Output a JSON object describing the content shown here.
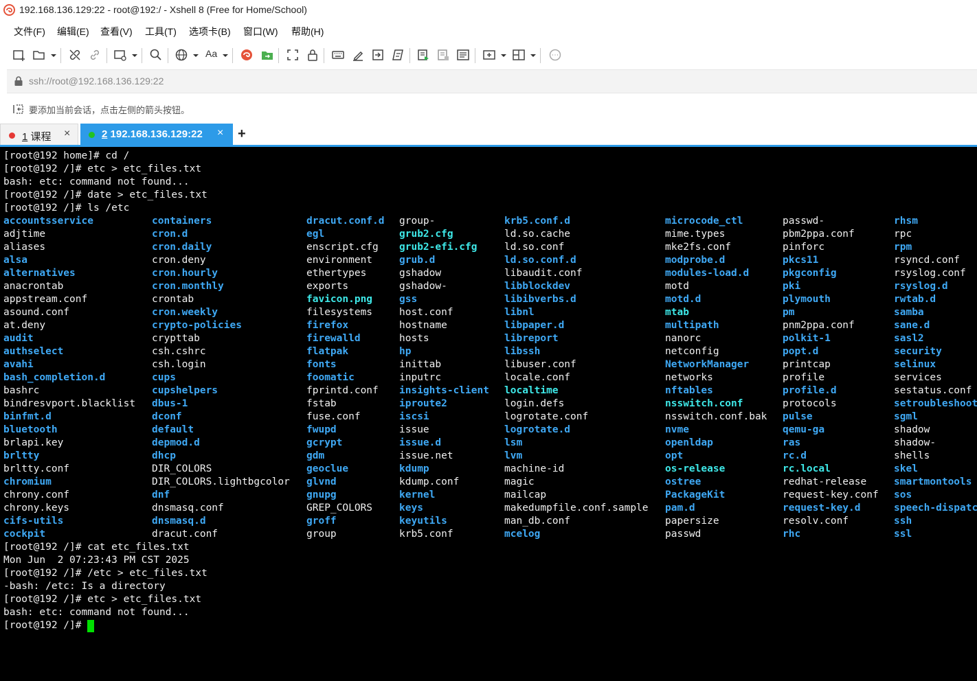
{
  "window": {
    "title": "192.168.136.129:22 - root@192:/ - Xshell 8 (Free for Home/School)"
  },
  "menu": [
    "文件(F)",
    "编辑(E)",
    "查看(V)",
    "工具(T)",
    "选项卡(B)",
    "窗口(W)",
    "帮助(H)"
  ],
  "toolbar": {
    "font_label": "Aa"
  },
  "address": {
    "value": "ssh://root@192.168.136.129:22"
  },
  "hint": {
    "text": "要添加当前会话，点击左侧的箭头按钮。"
  },
  "tabs": [
    {
      "num": "1",
      "label": " 课程",
      "status_color": "#e53935",
      "active": false
    },
    {
      "num": "2",
      "label": " 192.168.136.129:22",
      "status_color": "#22c322",
      "active": true
    }
  ],
  "tab_close_glyph": "×",
  "tab_add_glyph": "+",
  "colors": {
    "accent": "#2d9be8",
    "dir": "#3fa9f5",
    "link": "#3ee8e8",
    "cursor": "#00e000"
  },
  "terminal": {
    "lines_before": [
      "[root@192 home]# cd /",
      "[root@192 /]# etc > etc_files.txt",
      "bash: etc: command not found...",
      "[root@192 /]# date > etc_files.txt",
      "[root@192 /]# ls /etc"
    ],
    "ls_columns": [
      [
        {
          "n": "accountsservice",
          "t": "dir"
        },
        {
          "n": "adjtime",
          "t": "file"
        },
        {
          "n": "aliases",
          "t": "file"
        },
        {
          "n": "alsa",
          "t": "dir"
        },
        {
          "n": "alternatives",
          "t": "dir"
        },
        {
          "n": "anacrontab",
          "t": "file"
        },
        {
          "n": "appstream.conf",
          "t": "file"
        },
        {
          "n": "asound.conf",
          "t": "file"
        },
        {
          "n": "at.deny",
          "t": "file"
        },
        {
          "n": "audit",
          "t": "dir"
        },
        {
          "n": "authselect",
          "t": "dir"
        },
        {
          "n": "avahi",
          "t": "dir"
        },
        {
          "n": "bash_completion.d",
          "t": "dir"
        },
        {
          "n": "bashrc",
          "t": "file"
        },
        {
          "n": "bindresvport.blacklist",
          "t": "file"
        },
        {
          "n": "binfmt.d",
          "t": "dir"
        },
        {
          "n": "bluetooth",
          "t": "dir"
        },
        {
          "n": "brlapi.key",
          "t": "file"
        },
        {
          "n": "brltty",
          "t": "dir"
        },
        {
          "n": "brltty.conf",
          "t": "file"
        },
        {
          "n": "chromium",
          "t": "dir"
        },
        {
          "n": "chrony.conf",
          "t": "file"
        },
        {
          "n": "chrony.keys",
          "t": "file"
        },
        {
          "n": "cifs-utils",
          "t": "dir"
        },
        {
          "n": "cockpit",
          "t": "dir"
        }
      ],
      [
        {
          "n": "containers",
          "t": "dir"
        },
        {
          "n": "cron.d",
          "t": "dir"
        },
        {
          "n": "cron.daily",
          "t": "dir"
        },
        {
          "n": "cron.deny",
          "t": "file"
        },
        {
          "n": "cron.hourly",
          "t": "dir"
        },
        {
          "n": "cron.monthly",
          "t": "dir"
        },
        {
          "n": "crontab",
          "t": "file"
        },
        {
          "n": "cron.weekly",
          "t": "dir"
        },
        {
          "n": "crypto-policies",
          "t": "dir"
        },
        {
          "n": "crypttab",
          "t": "file"
        },
        {
          "n": "csh.cshrc",
          "t": "file"
        },
        {
          "n": "csh.login",
          "t": "file"
        },
        {
          "n": "cups",
          "t": "dir"
        },
        {
          "n": "cupshelpers",
          "t": "dir"
        },
        {
          "n": "dbus-1",
          "t": "dir"
        },
        {
          "n": "dconf",
          "t": "dir"
        },
        {
          "n": "default",
          "t": "dir"
        },
        {
          "n": "depmod.d",
          "t": "dir"
        },
        {
          "n": "dhcp",
          "t": "dir"
        },
        {
          "n": "DIR_COLORS",
          "t": "file"
        },
        {
          "n": "DIR_COLORS.lightbgcolor",
          "t": "file"
        },
        {
          "n": "dnf",
          "t": "dir"
        },
        {
          "n": "dnsmasq.conf",
          "t": "file"
        },
        {
          "n": "dnsmasq.d",
          "t": "dir"
        },
        {
          "n": "dracut.conf",
          "t": "file"
        }
      ],
      [
        {
          "n": "dracut.conf.d",
          "t": "dir"
        },
        {
          "n": "egl",
          "t": "dir"
        },
        {
          "n": "enscript.cfg",
          "t": "file"
        },
        {
          "n": "environment",
          "t": "file"
        },
        {
          "n": "ethertypes",
          "t": "file"
        },
        {
          "n": "exports",
          "t": "file"
        },
        {
          "n": "favicon.png",
          "t": "link"
        },
        {
          "n": "filesystems",
          "t": "file"
        },
        {
          "n": "firefox",
          "t": "dir"
        },
        {
          "n": "firewalld",
          "t": "dir"
        },
        {
          "n": "flatpak",
          "t": "dir"
        },
        {
          "n": "fonts",
          "t": "dir"
        },
        {
          "n": "foomatic",
          "t": "dir"
        },
        {
          "n": "fprintd.conf",
          "t": "file"
        },
        {
          "n": "fstab",
          "t": "file"
        },
        {
          "n": "fuse.conf",
          "t": "file"
        },
        {
          "n": "fwupd",
          "t": "dir"
        },
        {
          "n": "gcrypt",
          "t": "dir"
        },
        {
          "n": "gdm",
          "t": "dir"
        },
        {
          "n": "geoclue",
          "t": "dir"
        },
        {
          "n": "glvnd",
          "t": "dir"
        },
        {
          "n": "gnupg",
          "t": "dir"
        },
        {
          "n": "GREP_COLORS",
          "t": "file"
        },
        {
          "n": "groff",
          "t": "dir"
        },
        {
          "n": "group",
          "t": "file"
        }
      ],
      [
        {
          "n": "group-",
          "t": "file"
        },
        {
          "n": "grub2.cfg",
          "t": "link"
        },
        {
          "n": "grub2-efi.cfg",
          "t": "link"
        },
        {
          "n": "grub.d",
          "t": "dir"
        },
        {
          "n": "gshadow",
          "t": "file"
        },
        {
          "n": "gshadow-",
          "t": "file"
        },
        {
          "n": "gss",
          "t": "dir"
        },
        {
          "n": "host.conf",
          "t": "file"
        },
        {
          "n": "hostname",
          "t": "file"
        },
        {
          "n": "hosts",
          "t": "file"
        },
        {
          "n": "hp",
          "t": "dir"
        },
        {
          "n": "inittab",
          "t": "file"
        },
        {
          "n": "inputrc",
          "t": "file"
        },
        {
          "n": "insights-client",
          "t": "dir"
        },
        {
          "n": "iproute2",
          "t": "dir"
        },
        {
          "n": "iscsi",
          "t": "dir"
        },
        {
          "n": "issue",
          "t": "file"
        },
        {
          "n": "issue.d",
          "t": "dir"
        },
        {
          "n": "issue.net",
          "t": "file"
        },
        {
          "n": "kdump",
          "t": "dir"
        },
        {
          "n": "kdump.conf",
          "t": "file"
        },
        {
          "n": "kernel",
          "t": "dir"
        },
        {
          "n": "keys",
          "t": "dir"
        },
        {
          "n": "keyutils",
          "t": "dir"
        },
        {
          "n": "krb5.conf",
          "t": "file"
        }
      ],
      [
        {
          "n": "krb5.conf.d",
          "t": "dir"
        },
        {
          "n": "ld.so.cache",
          "t": "file"
        },
        {
          "n": "ld.so.conf",
          "t": "file"
        },
        {
          "n": "ld.so.conf.d",
          "t": "dir"
        },
        {
          "n": "libaudit.conf",
          "t": "file"
        },
        {
          "n": "libblockdev",
          "t": "dir"
        },
        {
          "n": "libibverbs.d",
          "t": "dir"
        },
        {
          "n": "libnl",
          "t": "dir"
        },
        {
          "n": "libpaper.d",
          "t": "dir"
        },
        {
          "n": "libreport",
          "t": "dir"
        },
        {
          "n": "libssh",
          "t": "dir"
        },
        {
          "n": "libuser.conf",
          "t": "file"
        },
        {
          "n": "locale.conf",
          "t": "file"
        },
        {
          "n": "localtime",
          "t": "link"
        },
        {
          "n": "login.defs",
          "t": "file"
        },
        {
          "n": "logrotate.conf",
          "t": "file"
        },
        {
          "n": "logrotate.d",
          "t": "dir"
        },
        {
          "n": "lsm",
          "t": "dir"
        },
        {
          "n": "lvm",
          "t": "dir"
        },
        {
          "n": "machine-id",
          "t": "file"
        },
        {
          "n": "magic",
          "t": "file"
        },
        {
          "n": "mailcap",
          "t": "file"
        },
        {
          "n": "makedumpfile.conf.sample",
          "t": "file"
        },
        {
          "n": "man_db.conf",
          "t": "file"
        },
        {
          "n": "mcelog",
          "t": "dir"
        }
      ],
      [
        {
          "n": "microcode_ctl",
          "t": "dir"
        },
        {
          "n": "mime.types",
          "t": "file"
        },
        {
          "n": "mke2fs.conf",
          "t": "file"
        },
        {
          "n": "modprobe.d",
          "t": "dir"
        },
        {
          "n": "modules-load.d",
          "t": "dir"
        },
        {
          "n": "motd",
          "t": "file"
        },
        {
          "n": "motd.d",
          "t": "dir"
        },
        {
          "n": "mtab",
          "t": "link"
        },
        {
          "n": "multipath",
          "t": "dir"
        },
        {
          "n": "nanorc",
          "t": "file"
        },
        {
          "n": "netconfig",
          "t": "file"
        },
        {
          "n": "NetworkManager",
          "t": "dir"
        },
        {
          "n": "networks",
          "t": "file"
        },
        {
          "n": "nftables",
          "t": "dir"
        },
        {
          "n": "nsswitch.conf",
          "t": "link"
        },
        {
          "n": "nsswitch.conf.bak",
          "t": "file"
        },
        {
          "n": "nvme",
          "t": "dir"
        },
        {
          "n": "openldap",
          "t": "dir"
        },
        {
          "n": "opt",
          "t": "dir"
        },
        {
          "n": "os-release",
          "t": "link"
        },
        {
          "n": "ostree",
          "t": "dir"
        },
        {
          "n": "PackageKit",
          "t": "dir"
        },
        {
          "n": "pam.d",
          "t": "dir"
        },
        {
          "n": "papersize",
          "t": "file"
        },
        {
          "n": "passwd",
          "t": "file"
        }
      ],
      [
        {
          "n": "passwd-",
          "t": "file"
        },
        {
          "n": "pbm2ppa.conf",
          "t": "file"
        },
        {
          "n": "pinforc",
          "t": "file"
        },
        {
          "n": "pkcs11",
          "t": "dir"
        },
        {
          "n": "pkgconfig",
          "t": "dir"
        },
        {
          "n": "pki",
          "t": "dir"
        },
        {
          "n": "plymouth",
          "t": "dir"
        },
        {
          "n": "pm",
          "t": "dir"
        },
        {
          "n": "pnm2ppa.conf",
          "t": "file"
        },
        {
          "n": "polkit-1",
          "t": "dir"
        },
        {
          "n": "popt.d",
          "t": "dir"
        },
        {
          "n": "printcap",
          "t": "file"
        },
        {
          "n": "profile",
          "t": "file"
        },
        {
          "n": "profile.d",
          "t": "dir"
        },
        {
          "n": "protocols",
          "t": "file"
        },
        {
          "n": "pulse",
          "t": "dir"
        },
        {
          "n": "qemu-ga",
          "t": "dir"
        },
        {
          "n": "ras",
          "t": "dir"
        },
        {
          "n": "rc.d",
          "t": "dir"
        },
        {
          "n": "rc.local",
          "t": "link"
        },
        {
          "n": "redhat-release",
          "t": "file"
        },
        {
          "n": "request-key.conf",
          "t": "file"
        },
        {
          "n": "request-key.d",
          "t": "dir"
        },
        {
          "n": "resolv.conf",
          "t": "file"
        },
        {
          "n": "rhc",
          "t": "dir"
        }
      ],
      [
        {
          "n": "rhsm",
          "t": "dir"
        },
        {
          "n": "rpc",
          "t": "file"
        },
        {
          "n": "rpm",
          "t": "dir"
        },
        {
          "n": "rsyncd.conf",
          "t": "file"
        },
        {
          "n": "rsyslog.conf",
          "t": "file"
        },
        {
          "n": "rsyslog.d",
          "t": "dir"
        },
        {
          "n": "rwtab.d",
          "t": "dir"
        },
        {
          "n": "samba",
          "t": "dir"
        },
        {
          "n": "sane.d",
          "t": "dir"
        },
        {
          "n": "sasl2",
          "t": "dir"
        },
        {
          "n": "security",
          "t": "dir"
        },
        {
          "n": "selinux",
          "t": "dir"
        },
        {
          "n": "services",
          "t": "file"
        },
        {
          "n": "sestatus.conf",
          "t": "file"
        },
        {
          "n": "setroubleshoot",
          "t": "dir"
        },
        {
          "n": "sgml",
          "t": "dir"
        },
        {
          "n": "shadow",
          "t": "file"
        },
        {
          "n": "shadow-",
          "t": "file"
        },
        {
          "n": "shells",
          "t": "file"
        },
        {
          "n": "skel",
          "t": "dir"
        },
        {
          "n": "smartmontools",
          "t": "dir"
        },
        {
          "n": "sos",
          "t": "dir"
        },
        {
          "n": "speech-dispatcher",
          "t": "dir"
        },
        {
          "n": "ssh",
          "t": "dir"
        },
        {
          "n": "ssl",
          "t": "dir"
        }
      ]
    ],
    "lines_after": [
      "[root@192 /]# cat etc_files.txt",
      "Mon Jun  2 07:23:43 PM CST 2025",
      "[root@192 /]# /etc > etc_files.txt",
      "-bash: /etc: Is a directory",
      "[root@192 /]# etc > etc_files.txt",
      "bash: etc: command not found...",
      "[root@192 /]# "
    ]
  }
}
